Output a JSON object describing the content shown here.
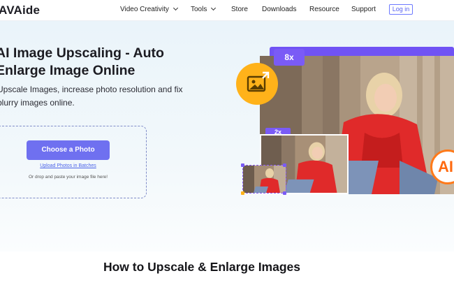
{
  "header": {
    "logo": "AVAide",
    "nav": [
      {
        "label": "Video Creativity",
        "dropdown": true
      },
      {
        "label": "Tools",
        "dropdown": true
      },
      {
        "label": "Store",
        "dropdown": false
      },
      {
        "label": "Downloads",
        "dropdown": false
      },
      {
        "label": "Resource",
        "dropdown": false
      },
      {
        "label": "Support",
        "dropdown": false
      }
    ],
    "login_label": "Log in"
  },
  "hero": {
    "title_line1": "AI Image Upscaling - Auto",
    "title_line2": "Enlarge Image Online",
    "subtitle_line1": "Upscale Images, increase photo resolution and fix",
    "subtitle_line2": "blurry images online.",
    "choose_button": "Choose a Photo",
    "batch_link": "Upload Photos in Batches",
    "drop_hint": "Or drop and paste your image file here!"
  },
  "illustration": {
    "badge_large": "8x",
    "badge_small": "2x",
    "ai_label": "AI",
    "icons": [
      "image-upload-icon"
    ]
  },
  "section": {
    "title": "How to Upscale & Enlarge Images"
  },
  "colors": {
    "accent": "#6f70f0",
    "badge": "#7a5bf6",
    "icon_yellow": "#ffb21a",
    "ai_orange": "#ff6a10",
    "link": "#4a62e8"
  }
}
